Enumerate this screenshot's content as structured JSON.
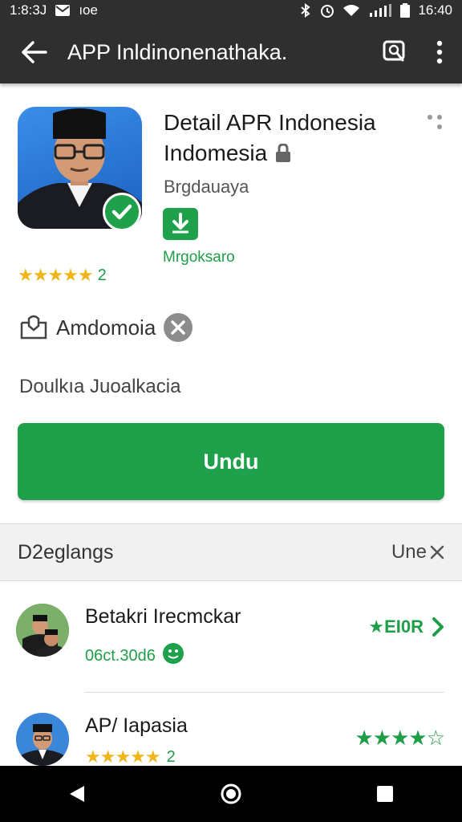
{
  "status_bar": {
    "time_left": "1:8:3J",
    "carrier": "ıoe",
    "time_right": "16:40"
  },
  "toolbar": {
    "title": "APP Inldinonenathaka."
  },
  "app": {
    "title_line1": "Detail APR Indonesia",
    "title_line2": "Indomesia",
    "developer": "Brgdauaya",
    "download_label": "Mrgoksaro",
    "rating_stars": "★★★★★",
    "rating_count": "2",
    "tag_label": "Amdomoia",
    "description": "Doulkıa Juoalkacia",
    "install_label": "Undu"
  },
  "section": {
    "title": "D2eglangs",
    "action_label": "Une"
  },
  "list": [
    {
      "title": "Betakri Irecmckar",
      "subtitle": "06ct.30d6",
      "right_label": "★EI0R"
    },
    {
      "title": "AP/ Iapasia",
      "subtitle_stars": "★★★★★",
      "subtitle_count": "2",
      "right_stars": "★★★★☆"
    }
  ],
  "colors": {
    "accent": "#1ea14a",
    "toolbar": "#2f2f2f",
    "star": "#f1b51c"
  }
}
